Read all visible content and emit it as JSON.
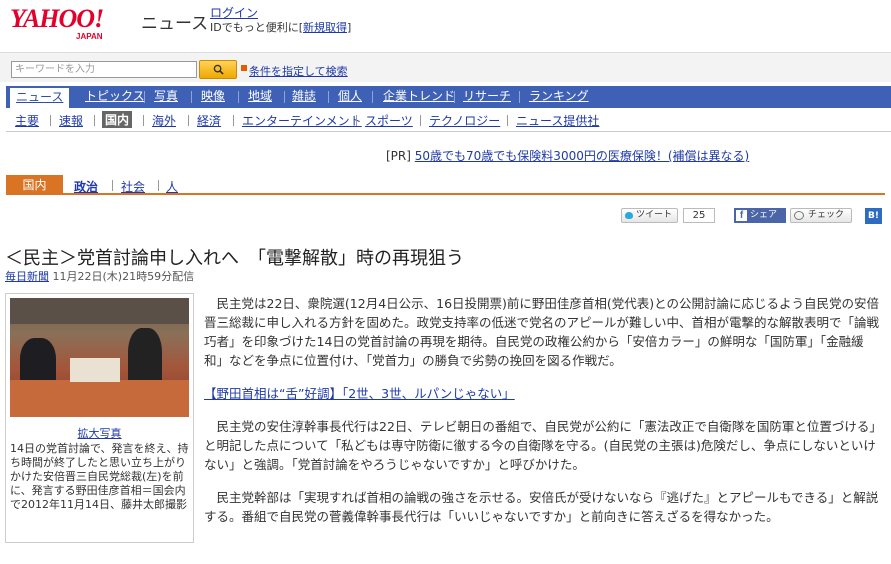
{
  "header": {
    "logo": "YAHOO!",
    "logo_sub": "JAPAN",
    "site_name": "ニュース",
    "login_label": "ログイン",
    "login_sub_prefix": "IDでもっと便利に[",
    "register_label": "新規取得",
    "login_sub_suffix": "]"
  },
  "search": {
    "placeholder": "キーワードを入力",
    "advanced_label": "条件を指定して検索"
  },
  "nav": {
    "items": [
      "ニュース",
      "トピックス",
      "写真",
      "映像",
      "地域",
      "雑誌",
      "個人",
      "企業トレンド",
      "リサーチ",
      "ランキング"
    ]
  },
  "subnav": {
    "items": [
      "主要",
      "速報",
      "国内",
      "海外",
      "経済",
      "エンターテインメント",
      "スポーツ",
      "テクノロジー",
      "ニュース提供社"
    ]
  },
  "pr": {
    "prefix": "[PR]",
    "text": "50歳でも70歳でも保険料3000円の医療保険！(補償は異なる)"
  },
  "category": {
    "active": "国内",
    "items": [
      "政治",
      "社会",
      "人"
    ]
  },
  "social": {
    "tweet_label": "ツイート",
    "tweet_count": "25",
    "share_label": "シェア",
    "check_label": "チェック",
    "hatena_label": "B!"
  },
  "article": {
    "headline": "＜民主＞党首討論申し入れへ　「電撃解散」時の再現狙う",
    "source": "毎日新聞",
    "date": " 11月22日(木)21時59分配信",
    "photo_enlarge": "拡大写真",
    "photo_caption": "14日の党首討論で、発言を終え、持ち時間が終了したと思い立ち上がりかけた安倍晋三自民党総裁(左)を前に、発言する野田佳彦首相＝国会内で2012年11月14日、藤井太郎撮影",
    "paragraph1": "民主党は22日、衆院選(12月4日公示、16日投開票)前に野田佳彦首相(党代表)との公開討論に応じるよう自民党の安倍晋三総裁に申し入れる方針を固めた。政党支持率の低迷で党名のアピールが難しい中、首相が電撃的な解散表明で「論戦巧者」を印象づけた14日の党首討論の再現を期待。自民党の政権公約から「安倍カラー」の鮮明な「国防軍」「金融緩和」などを争点に位置付け、「党首力」の勝負で劣勢の挽回を図る作戦だ。",
    "related_link": "【野田首相は“舌”好調】「2世、3世、ルパンじゃない」",
    "paragraph2": "民主党の安住淳幹事長代行は22日、テレビ朝日の番組で、自民党が公約に「憲法改正で自衛隊を国防軍と位置づける」と明記した点について「私どもは専守防衛に徹する今の自衛隊を守る。(自民党の主張は)危険だし、争点にしないといけない」と強調。「党首討論をやろうじゃないですか」と呼びかけた。",
    "paragraph3": "民主党幹部は「実現すれば首相の論戦の強さを示せる。安倍氏が受けないなら『逃げた』とアピールもできる」と解説する。番組で自民党の菅義偉幹事長代行は「いいじゃないですか」と前向きに答えざるを得なかった。"
  }
}
